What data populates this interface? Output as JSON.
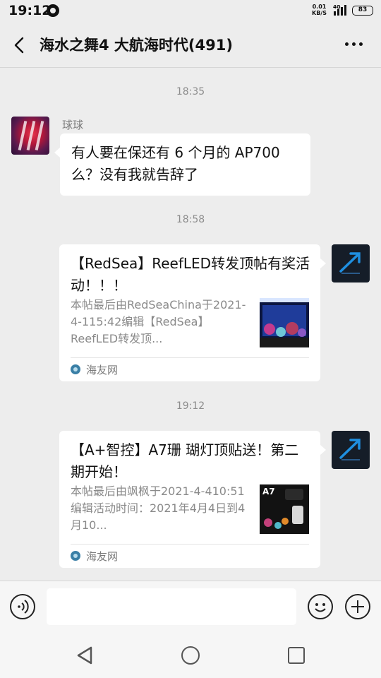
{
  "status_bar": {
    "time": "19:12",
    "net_speed_value": "0.01",
    "net_speed_unit": "KB/S",
    "network_type": "4G",
    "battery": "83"
  },
  "header": {
    "title": "海水之舞4 大航海时代(491)",
    "back_icon": "chevron-left-icon",
    "more_icon": "more-horizontal-icon"
  },
  "messages": [
    {
      "type": "timestamp",
      "text": "18:35"
    },
    {
      "type": "text",
      "side": "left",
      "sender": "球球",
      "avatar": "clownfish-avatar",
      "text": "有人要在保还有 6 个月的 AP700 么？没有我就告辞了"
    },
    {
      "type": "timestamp",
      "text": "18:58"
    },
    {
      "type": "link_card",
      "side": "right",
      "avatar": "arrow-logo-avatar",
      "title": "【RedSea】ReefLED转发顶帖有奖活动！！！",
      "desc": "本帖最后由RedSeaChina于2021-4-115:42编辑【RedSea】ReefLED转发顶...",
      "thumb": "aquarium-thumbnail",
      "source": "海友网"
    },
    {
      "type": "timestamp",
      "text": "19:12"
    },
    {
      "type": "link_card",
      "side": "right",
      "avatar": "arrow-logo-avatar",
      "title": "【A+智控】A7珊 瑚灯顶贴送！第二期开始！",
      "desc": "本帖最后由飒枫于2021-4-410:51编辑活动时间：2021年4月4日到4月10...",
      "thumb": "a7-product-thumbnail",
      "thumb_label": "A7",
      "source": "海友网"
    }
  ],
  "input_bar": {
    "voice_icon": "voice-input-icon",
    "placeholder": "",
    "emoji_icon": "emoji-icon",
    "plus_icon": "plus-icon"
  },
  "nav_bar": {
    "back_icon": "nav-back-icon",
    "home_icon": "nav-home-icon",
    "recent_icon": "nav-recent-icon"
  }
}
